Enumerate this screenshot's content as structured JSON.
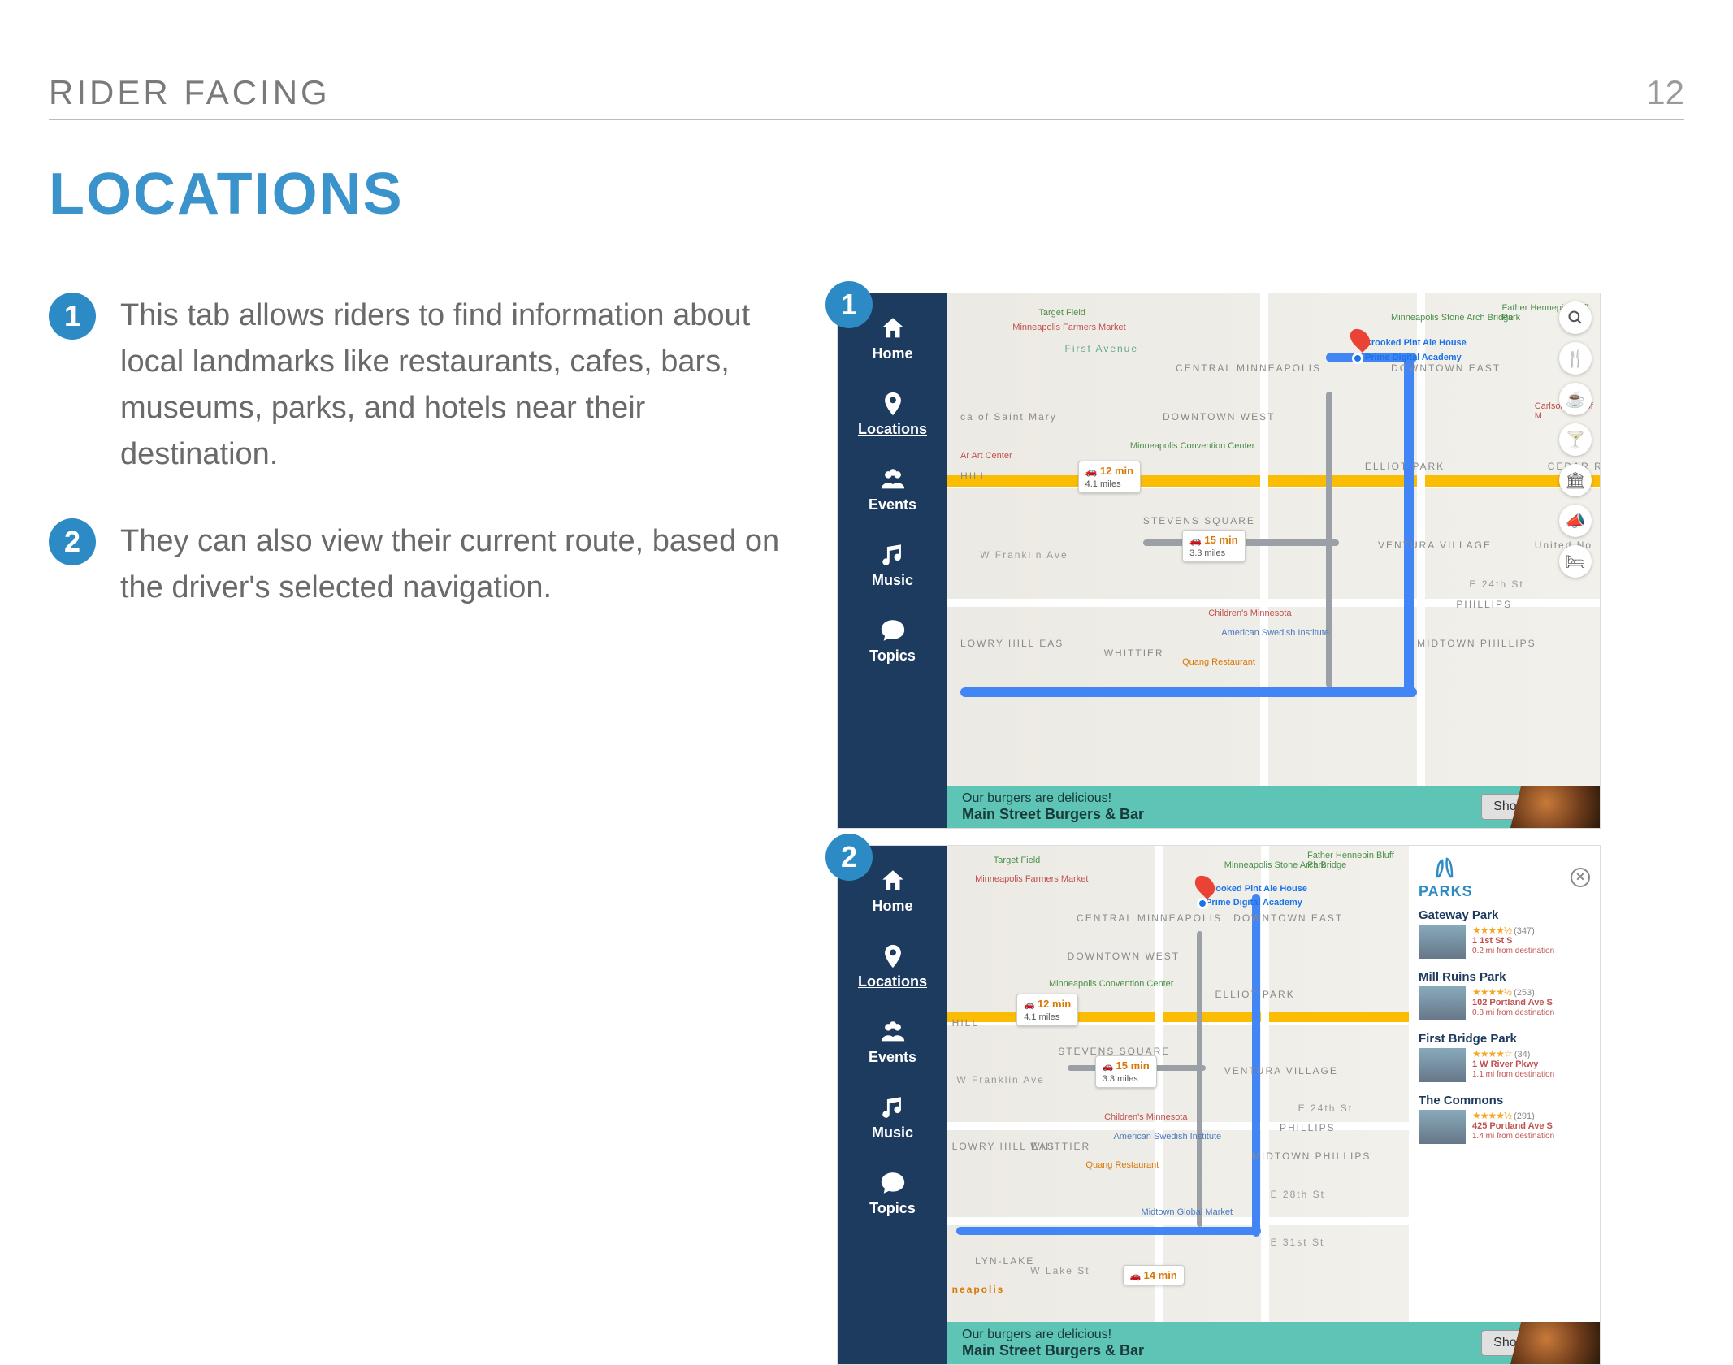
{
  "header": {
    "title": "RIDER FACING",
    "page": "12"
  },
  "title": "LOCATIONS",
  "bullets": [
    {
      "num": "1",
      "text": "This tab allows riders to find information about local landmarks like restaurants, cafes, bars, museums, parks, and hotels near their destination."
    },
    {
      "num": "2",
      "text": "They can also view their current route, based on the driver's selected navigation."
    }
  ],
  "callouts": [
    {
      "num": "1"
    },
    {
      "num": "2"
    }
  ],
  "nav": [
    {
      "label": "Home",
      "icon": "home"
    },
    {
      "label": "Locations",
      "icon": "pin",
      "active": true
    },
    {
      "label": "Events",
      "icon": "users"
    },
    {
      "label": "Music",
      "icon": "music"
    },
    {
      "label": "Topics",
      "icon": "chat"
    }
  ],
  "routes": [
    {
      "time": "12 min",
      "dist": "4.1 miles"
    },
    {
      "time": "15 min",
      "dist": "3.3 miles"
    },
    {
      "time": "14 min",
      "dist": ""
    }
  ],
  "map_pois": {
    "dest1": "Crooked Pint Ale House",
    "dest2": "Prime Digital Academy",
    "p1": "Minneapolis Farmers Market",
    "p2": "Target Field",
    "p3": "Minneapolis Convention Center",
    "p4": "Children's Minnesota",
    "p5": "American Swedish Institute",
    "p6": "Quang Restaurant",
    "p7": "Midtown Global Market",
    "p8": "Ar Art Center",
    "p9": "Father Hennepin Bluff Park",
    "p10": "Minneapolis Stone Arch Bridge",
    "p11": "Carlson Sch of M"
  },
  "neighborhoods": [
    "CENTRAL MINNEAPOLIS",
    "DOWNTOWN WEST",
    "DOWNTOWN EAST",
    "ELLIOT PARK",
    "STEVENS SQUARE",
    "VENTURA VILLAGE",
    "PHILLIPS",
    "MIDTOWN PHILLIPS",
    "WHITTIER",
    "LOWRY HILL EAS",
    "CEDAR RI",
    "HILL",
    "LYN-LAKE",
    "United No",
    "First Avenue",
    "ca of Saint Mary",
    "W Franklin Ave",
    "E 24th St",
    "W Lake St",
    "E 31st St",
    "E 28th St",
    "neapolis"
  ],
  "ad": {
    "line1": "Our burgers are delicious!",
    "line2": "Main Street Burgers & Bar",
    "button": "Show on Map"
  },
  "panel": {
    "title": "PARKS",
    "items": [
      {
        "name": "Gateway Park",
        "stars": "★★★★½",
        "count": "(347)",
        "addr": "1 1st St S",
        "dist": "0.2 mi from destination"
      },
      {
        "name": "Mill Ruins Park",
        "stars": "★★★★½",
        "count": "(253)",
        "addr": "102 Portland Ave S",
        "dist": "0.8 mi from destination"
      },
      {
        "name": "First Bridge Park",
        "stars": "★★★★☆",
        "count": "(34)",
        "addr": "1 W River Pkwy",
        "dist": "1.1 mi from destination"
      },
      {
        "name": "The Commons",
        "stars": "★★★★½",
        "count": "(291)",
        "addr": "425 Portland Ave S",
        "dist": "1.4 mi from destination"
      }
    ]
  },
  "map_tools": [
    "search",
    "food",
    "coffee",
    "drink",
    "museum",
    "horn",
    "bed"
  ]
}
